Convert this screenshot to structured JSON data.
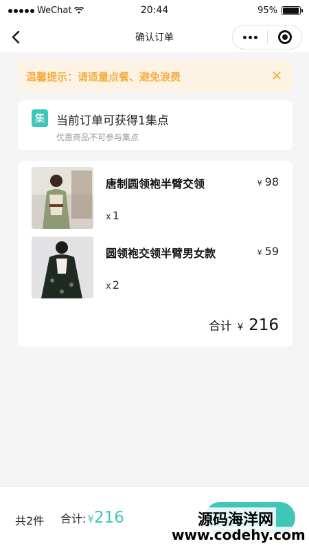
{
  "statusbar": {
    "carrier": "WeChat",
    "time": "20:44",
    "battery": "95%",
    "battery_level": 0.95
  },
  "navbar": {
    "title": "确认订单",
    "back_icon": "chevron-left-icon",
    "more_icon": "more-dots-icon",
    "close_icon": "target-icon"
  },
  "tip": {
    "text": "温馨提示：请适量点餐、避免浪费",
    "close": "✕",
    "color": "#f4b043"
  },
  "points": {
    "badge": "集",
    "title": "当前订单可获得1集点",
    "subtitle": "优惠商品不可参与集点"
  },
  "order": {
    "items": [
      {
        "name": "唐制圆领袍半臂交领",
        "currency": "¥",
        "price": "98",
        "qty_prefix": "x",
        "qty": "1"
      },
      {
        "name": "圆领袍交领半臂男女款",
        "currency": "¥",
        "price": "59",
        "qty_prefix": "x",
        "qty": "2"
      }
    ],
    "subtotal_label": "合计",
    "subtotal_currency": "¥",
    "subtotal_amount": "216"
  },
  "bottom": {
    "count": "共2件",
    "total_label": "合计:",
    "total_currency": "¥",
    "total_amount": "216",
    "accent": "#3fc6b8"
  },
  "watermark": {
    "line1": "源码海洋网",
    "line2": "www.codehy.com"
  }
}
